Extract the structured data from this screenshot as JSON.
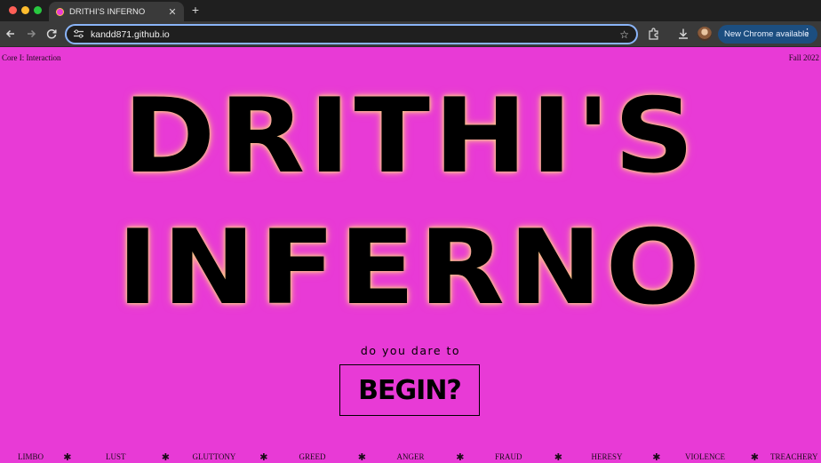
{
  "browser": {
    "tab_title": "DRITHI'S INFERNO",
    "tab_close": "✕",
    "new_tab": "+",
    "url": "kandd871.github.io",
    "update_label": "New Chrome available",
    "update_menu": "⋮"
  },
  "page": {
    "corner_left": "Core I: Interaction",
    "corner_right": "Fall 2022",
    "hero_line1": "DRITHI'S",
    "hero_line2": "INFERNO",
    "prompt": "do you dare to",
    "begin_label": "BEGIN?"
  },
  "circles": {
    "separator": "✱",
    "items": [
      "LIMBO",
      "LUST",
      "GLUTTONY",
      "GREED",
      "ANGER",
      "FRAUD",
      "HERESY",
      "VIOLENCE",
      "TREACHERY"
    ]
  },
  "colors": {
    "background": "#e83ad6",
    "text": "#000000",
    "glow": "#ffc98a"
  },
  "icons": {
    "back": "arrow-left-icon",
    "forward": "arrow-right-icon",
    "reload": "reload-icon",
    "site_settings": "tune-icon",
    "bookmark": "star-icon",
    "extensions": "puzzle-icon",
    "download": "download-icon"
  }
}
